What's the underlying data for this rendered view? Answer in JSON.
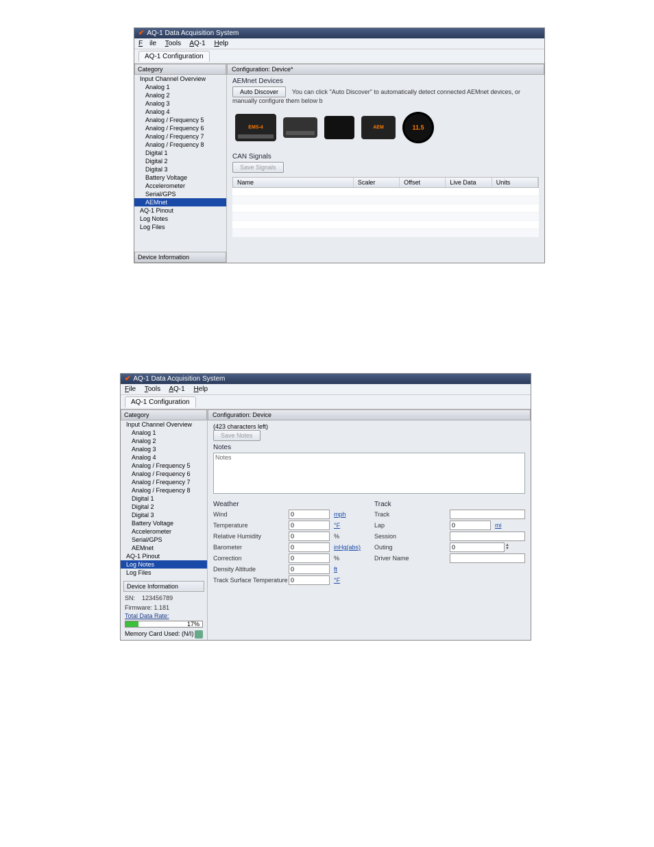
{
  "window1": {
    "title": "AQ-1 Data Acquisition System",
    "menu": {
      "file": "File",
      "tools": "Tools",
      "aq1": "AQ-1",
      "help": "Help"
    },
    "tab": "AQ-1 Configuration",
    "sidebar": {
      "header": "Category",
      "items": [
        "Input Channel Overview",
        "Analog 1",
        "Analog 2",
        "Analog 3",
        "Analog 4",
        "Analog / Frequency 5",
        "Analog / Frequency 6",
        "Analog / Frequency 7",
        "Analog / Frequency 8",
        "Digital 1",
        "Digital 2",
        "Digital 3",
        "Battery Voltage",
        "Accelerometer",
        "Serial/GPS",
        "AEMnet",
        "AQ-1 Pinout",
        "Log Notes",
        "Log Files"
      ],
      "selected_index": 15,
      "footer": "Device Information"
    },
    "main": {
      "header": "Configuration: Device*",
      "devices_title": "AEMnet Devices",
      "auto_discover": "Auto Discover",
      "auto_discover_hint": "You can click \"Auto Discover\" to automatically detect connected AEMnet devices, or manually configure them below b",
      "gauge_value": "11.5",
      "can_title": "CAN Signals",
      "save_signals": "Save Signals",
      "table": {
        "c1": "Name",
        "c2": "Scaler",
        "c3": "Offset",
        "c4": "Live Data",
        "c5": "Units"
      }
    }
  },
  "window2": {
    "title": "AQ-1 Data Acquisition System",
    "menu": {
      "file": "File",
      "tools": "Tools",
      "aq1": "AQ-1",
      "help": "Help"
    },
    "tab": "AQ-1 Configuration",
    "sidebar": {
      "header": "Category",
      "items": [
        "Input Channel Overview",
        "Analog 1",
        "Analog 2",
        "Analog 3",
        "Analog 4",
        "Analog / Frequency 5",
        "Analog / Frequency 6",
        "Analog / Frequency 7",
        "Analog / Frequency 8",
        "Digital 1",
        "Digital 2",
        "Digital 3",
        "Battery Voltage",
        "Accelerometer",
        "Serial/GPS",
        "AEMnet",
        "AQ-1 Pinout",
        "Log Notes",
        "Log Files"
      ],
      "selected_index": 17,
      "devinfo_header": "Device Information",
      "sn_label": "SN:",
      "sn_value": "123456789",
      "fw_label": "Firmware:",
      "fw_value": "1.181",
      "total_rate_label": "Total Data Rate:",
      "total_rate_pct": "17%",
      "mem_label": "Memory Card Used: (N/I)"
    },
    "main": {
      "header": "Configuration: Device",
      "chars_left": "(423 characters left)",
      "save_notes": "Save Notes",
      "notes_label": "Notes",
      "notes_placeholder": "Notes",
      "weather_title": "Weather",
      "track_title": "Track",
      "weather": {
        "wind": {
          "label": "Wind",
          "value": "0",
          "unit": "mph"
        },
        "temp": {
          "label": "Temperature",
          "value": "0",
          "unit": "°F"
        },
        "rh": {
          "label": "Relative Humidity",
          "value": "0",
          "unit": "%"
        },
        "baro": {
          "label": "Barometer",
          "value": "0",
          "unit": "inHg(abs)"
        },
        "corr": {
          "label": "Correction",
          "value": "0",
          "unit": "%"
        },
        "da": {
          "label": "Density Altitude",
          "value": "0",
          "unit": "ft"
        },
        "tst": {
          "label": "Track Surface Temperature",
          "value": "0",
          "unit": "°F"
        }
      },
      "track": {
        "track": {
          "label": "Track",
          "value": ""
        },
        "lap": {
          "label": "Lap",
          "value": "0",
          "unit": "mi"
        },
        "session": {
          "label": "Session",
          "value": ""
        },
        "outing": {
          "label": "Outing",
          "value": "0"
        },
        "driver": {
          "label": "Driver Name",
          "value": ""
        }
      }
    }
  }
}
